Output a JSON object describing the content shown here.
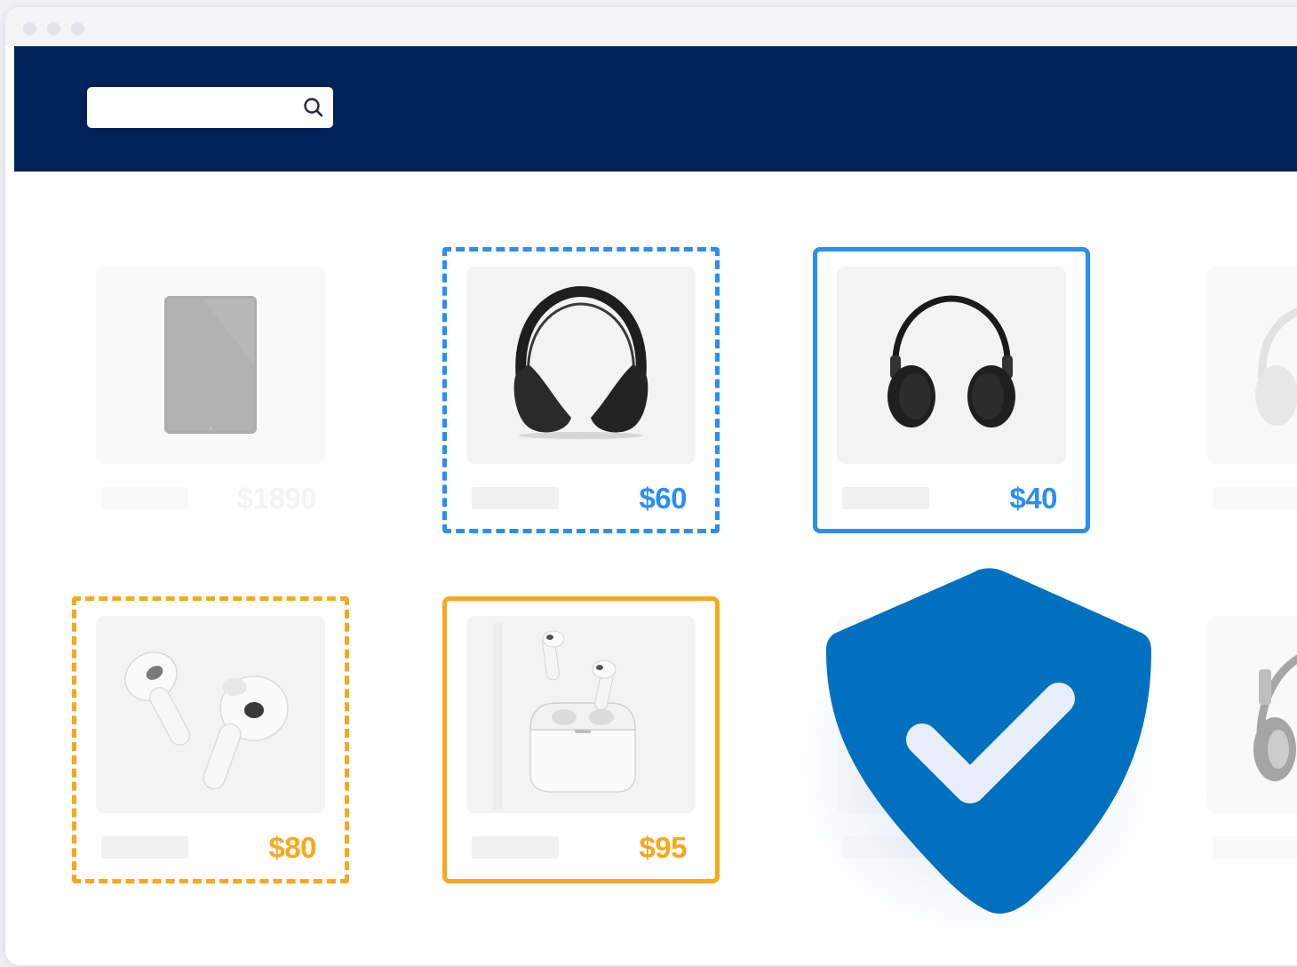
{
  "header": {
    "search": {
      "value": "",
      "placeholder": "",
      "icon": "search-icon"
    }
  },
  "products": [
    {
      "id": "tablet",
      "price": "$1890",
      "state": "faded",
      "icon": "tablet-icon"
    },
    {
      "id": "headphones-large",
      "price": "$60",
      "state": "dashed-blue",
      "icon": "headphones-icon"
    },
    {
      "id": "headphones-small",
      "price": "$40",
      "state": "solid-blue",
      "icon": "headphones-icon"
    },
    {
      "id": "headphones-partial-top",
      "price": "",
      "state": "faded",
      "icon": "headphones-icon"
    },
    {
      "id": "airpods",
      "price": "$80",
      "state": "dashed-orange",
      "icon": "earbuds-icon"
    },
    {
      "id": "airpods-pro-case",
      "price": "$95",
      "state": "solid-orange",
      "icon": "earbuds-case-icon"
    },
    {
      "id": "hidden-under-shield",
      "price": "",
      "state": "hidden",
      "icon": ""
    },
    {
      "id": "headphones-partial-bottom",
      "price": "",
      "state": "faded",
      "icon": "headphones-icon"
    }
  ],
  "badge": {
    "icon": "shield-check-icon"
  },
  "colors": {
    "navbar": "#002357",
    "blue_accent": "#2b8ef0",
    "orange_accent": "#f7a81e",
    "shield": "#0070bf"
  }
}
